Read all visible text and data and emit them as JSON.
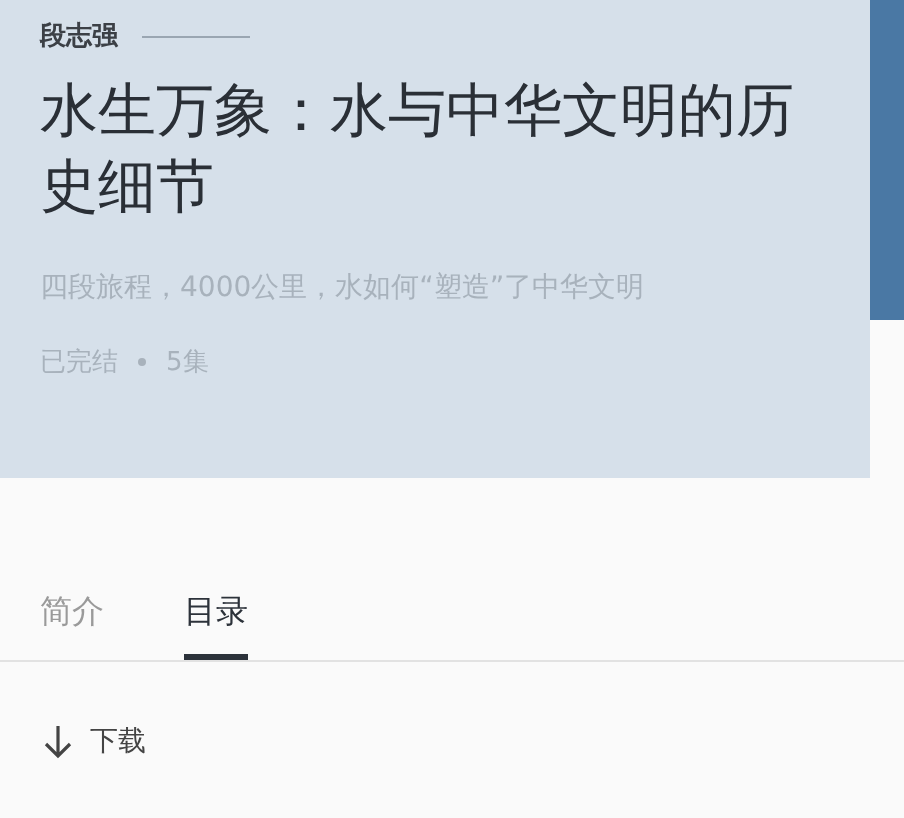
{
  "header": {
    "author": "段志强",
    "title": "水生万象：水与中华文明的历史细节",
    "subtitle": "四段旅程，4000公里，水如何“塑造”了中华文明",
    "status": "已完结",
    "episodes": "5集"
  },
  "tabs": [
    {
      "label": "简介",
      "selected": false
    },
    {
      "label": "目录",
      "selected": true
    }
  ],
  "download": {
    "label": "下载"
  }
}
